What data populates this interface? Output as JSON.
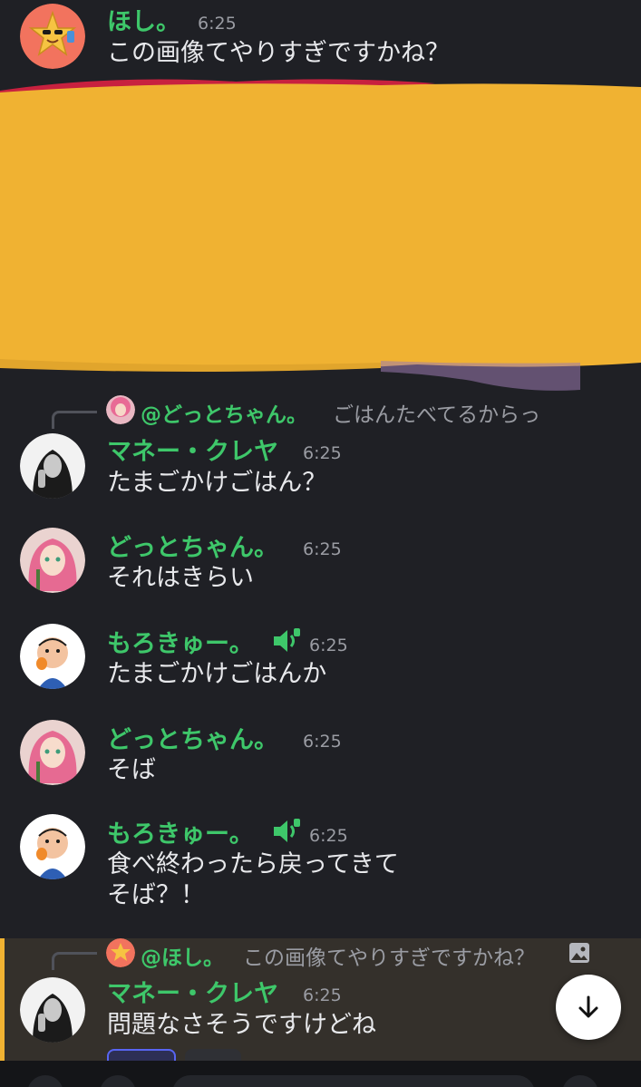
{
  "messages": [
    {
      "author": "ほし。",
      "time": "6:25",
      "lines": [
        "この画像てやりすぎですかね？"
      ]
    },
    {
      "author": "マネー・クレヤ",
      "time": "6:25",
      "lines": [
        "たまごかけごはん？"
      ],
      "reply": {
        "mention": "@どっとちゃん。",
        "text": "ごはんたべてるからっ"
      }
    },
    {
      "author": "どっとちゃん。",
      "time": "6:25",
      "lines": [
        "それはきらい"
      ]
    },
    {
      "author": "もろきゅー。",
      "time": "6:25",
      "lines": [
        "たまごかけごはんか"
      ],
      "icon": "speaker-icon"
    },
    {
      "author": "どっとちゃん。",
      "time": "6:25",
      "lines": [
        "そば"
      ]
    },
    {
      "author": "もろきゅー。",
      "time": "6:25",
      "lines": [
        "食べ終わったら戻ってきて",
        "そば？！"
      ],
      "icon": "speaker-icon"
    },
    {
      "author": "マネー・クレヤ",
      "time": "6:25",
      "lines": [
        "問題なさそうですけどね"
      ],
      "reply": {
        "mention": "@ほし。",
        "text": "この画像てやりすぎですかね？",
        "icon": "image-icon"
      }
    }
  ],
  "colors": {
    "background": "#1f2025",
    "name": "#3ec76a",
    "time": "#9a9ca3",
    "text": "#e8e9ec",
    "highlight_bg": "#34302b",
    "highlight_bar": "#f0b232",
    "redaction": "#f0b232"
  },
  "icons": {
    "scroll_down": "arrow-down-icon",
    "attachment": "image-icon"
  }
}
